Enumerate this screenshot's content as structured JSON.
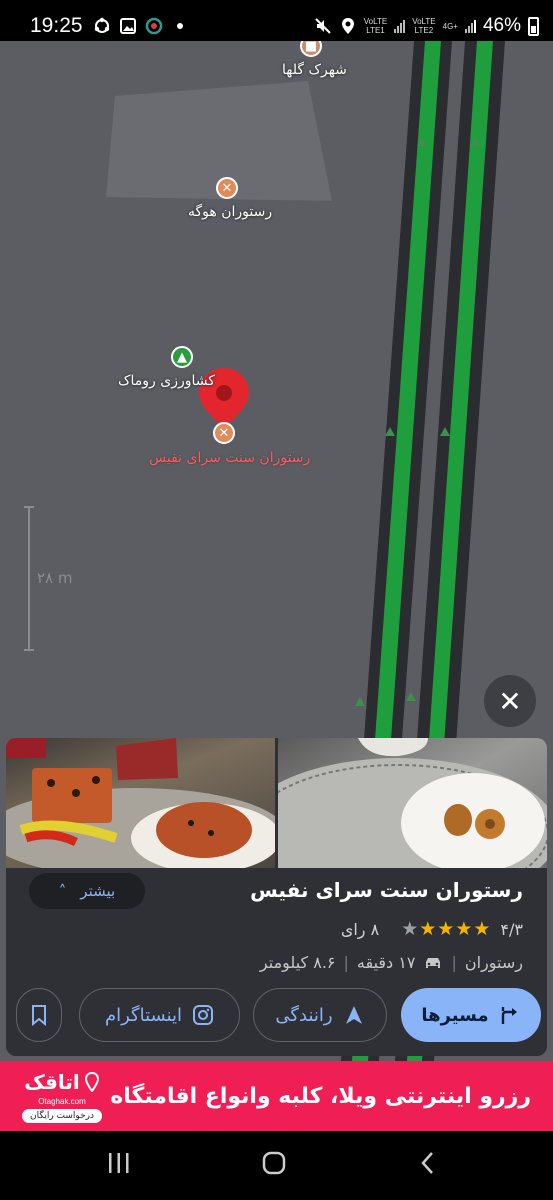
{
  "status_bar": {
    "time": "19:25",
    "battery": "46%",
    "sim1": "LTE1",
    "sim2": "LTE2",
    "network": "4G+",
    "volte1": "VoLTE",
    "volte2": "VoLTE"
  },
  "map": {
    "pois": [
      {
        "label": "شهرک گلها",
        "icon": "shop-icon"
      },
      {
        "label": "رستوران هوگه",
        "icon": "restaurant-icon"
      },
      {
        "label": "کشاورزی روماک",
        "icon": "tree-icon"
      },
      {
        "label": "رستوران سنت سرای نفیس",
        "icon": "restaurant-icon"
      }
    ],
    "scale": "۲۸ m"
  },
  "place": {
    "name": "رستوران سنت سرای نفیس",
    "more_label": "بیشتر",
    "rating": "۴/۳",
    "rating_value": 4.3,
    "reviews": "۸ رای",
    "category": "رستوران",
    "duration": "۱۷ دقیقه",
    "distance": "۸.۶ کیلومتر",
    "actions": {
      "directions": "مسیرها",
      "drive": "رانندگی",
      "instagram": "اینستاگرام"
    }
  },
  "ad": {
    "text": "رزرو اینترنتی ویلا، کلبه وانواع اقامتگاه",
    "brand": "اتاقک",
    "url": "Otaghak.com",
    "cta": "درخواست رایگان"
  },
  "colors": {
    "map_bg": "#5b5d63",
    "road_green": "#1e9e3d",
    "pin_red": "#e3262e",
    "accent_blue": "#8ab4f8",
    "ad_bg": "#ef1f56"
  }
}
